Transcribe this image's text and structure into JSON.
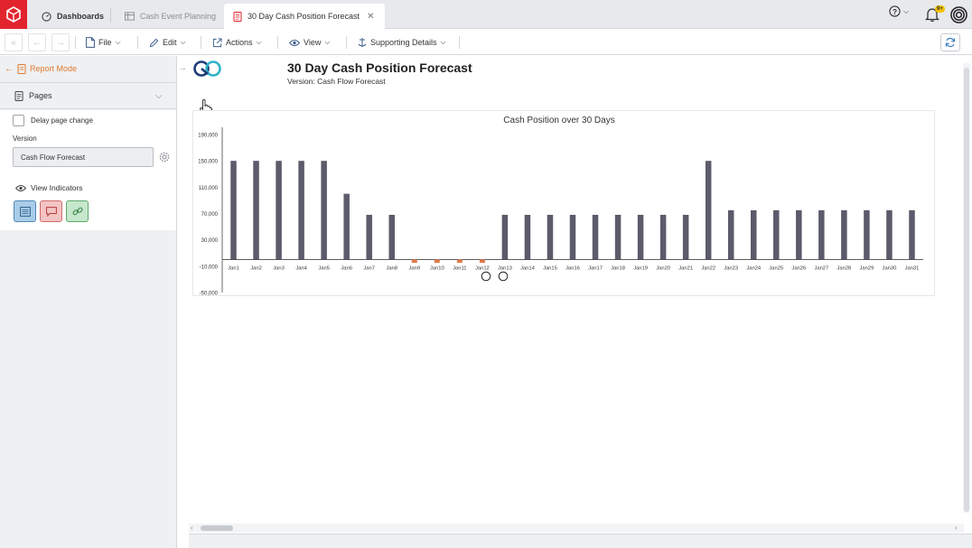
{
  "tabs": [
    {
      "label": "Dashboards",
      "icon": "dashboard-icon"
    },
    {
      "label": "Cash Event Planning",
      "icon": "table-icon"
    },
    {
      "label": "30 Day Cash Position Forecast",
      "icon": "report-icon"
    }
  ],
  "notifications": {
    "badge": "9+"
  },
  "toolbar": {
    "file": "File",
    "edit": "Edit",
    "actions": "Actions",
    "view": "View",
    "supporting": "Supporting Details"
  },
  "sidebar": {
    "mode": "Report Mode",
    "pages": "Pages",
    "delay_label": "Delay page change",
    "version_label": "Version",
    "version_value": "Cash Flow Forecast",
    "view_indicators": "View Indicators"
  },
  "report": {
    "title": "30 Day Cash Position Forecast",
    "version_line": "Version: Cash Flow Forecast"
  },
  "colors": {
    "accent": "#e07a2e",
    "bar_positive": "#5b5b6b",
    "bar_negative": "#e07a4a",
    "brand": "#e2242f"
  },
  "chart_data": {
    "type": "bar",
    "title": "Cash Position over 30 Days",
    "categories": [
      "Jan1",
      "Jan2",
      "Jan3",
      "Jan4",
      "Jan5",
      "Jan6",
      "Jan7",
      "Jan8",
      "Jan9",
      "Jan10",
      "Jan11",
      "Jan12",
      "Jan13",
      "Jan14",
      "Jan15",
      "Jan16",
      "Jan17",
      "Jan18",
      "Jan19",
      "Jan20",
      "Jan21",
      "Jan22",
      "Jan23",
      "Jan24",
      "Jan25",
      "Jan26",
      "Jan27",
      "Jan28",
      "Jan29",
      "Jan30",
      "Jan31"
    ],
    "values": [
      150000,
      150000,
      150000,
      150000,
      150000,
      100000,
      68000,
      68000,
      -5000,
      -5000,
      -5000,
      -5000,
      68000,
      68000,
      68000,
      68000,
      68000,
      68000,
      68000,
      68000,
      68000,
      150000,
      75000,
      75000,
      75000,
      75000,
      75000,
      75000,
      75000,
      75000,
      75000
    ],
    "yticks": [
      190000,
      150000,
      110000,
      70000,
      30000,
      -10000,
      -50000
    ],
    "ytick_labels": [
      "190,000",
      "150,000",
      "110,000",
      "70,000",
      "30,000",
      "-10,000",
      "-50,000"
    ],
    "ylim": [
      -50000,
      190000
    ],
    "xlabel": "",
    "ylabel": ""
  }
}
